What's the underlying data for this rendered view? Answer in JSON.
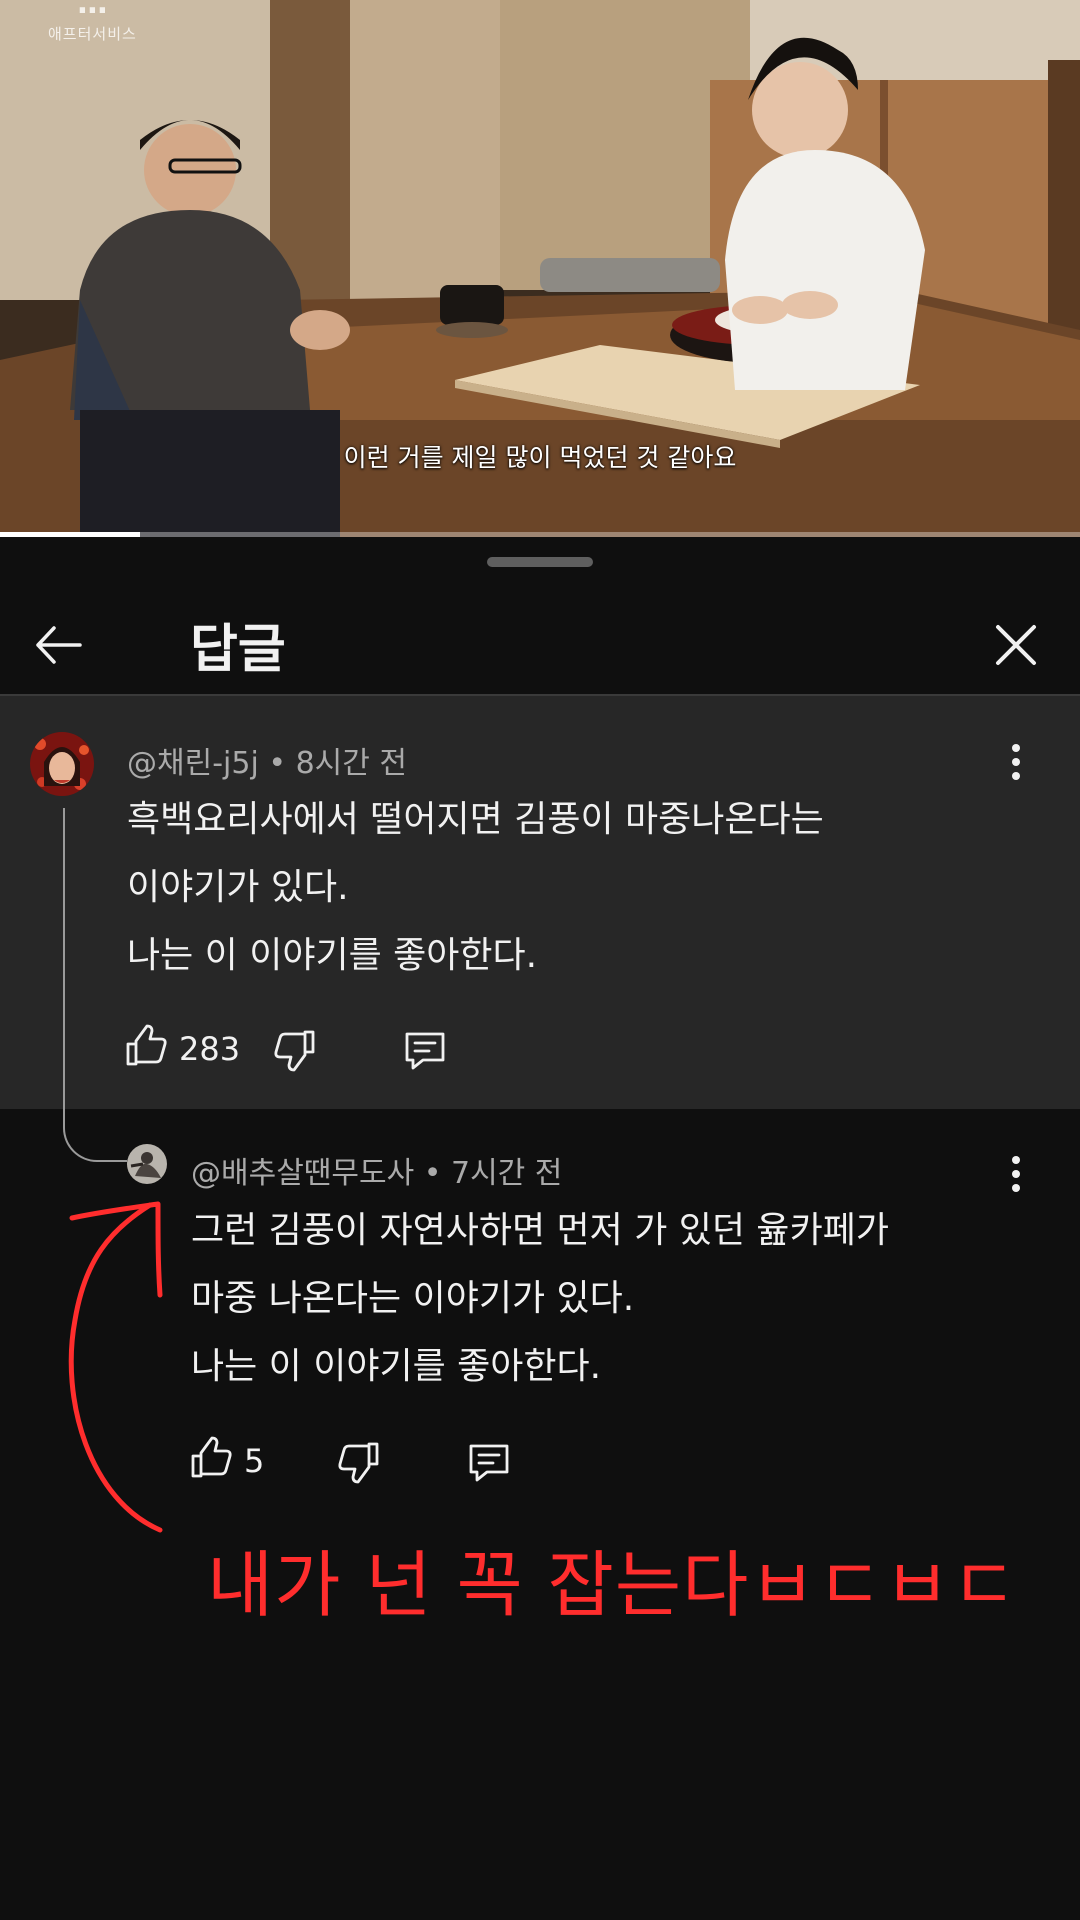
{
  "video": {
    "channel_logo_line1": "…",
    "channel_logo_line2": "애프터서비스",
    "subtitle": "이런 거를 제일 많이 먹었던 것 같아요",
    "progress_fraction": 0.13
  },
  "header": {
    "title": "답글"
  },
  "comment": {
    "author": "@채린-j5j",
    "time": "8시간 전",
    "lines": [
      "흑백요리사에서 떨어지면 김풍이 마중나온다는",
      "이야기가 있다.",
      "나는 이 이야기를 좋아한다."
    ],
    "like_count": "283"
  },
  "reply": {
    "author": "@배추살땐무도사",
    "time": "7시간 전",
    "lines": [
      "그런 김풍이 자연사하면 먼저 가 있던 윮카페가",
      "마중 나온다는 이야기가 있다.",
      "나는 이 이야기를 좋아한다."
    ],
    "like_count": "5"
  },
  "annotation": {
    "text": "내가 넌 꼭 잡는다ㅂㄷㅂㄷ",
    "color": "#ff2d2d"
  },
  "colors": {
    "background": "#0f0f0f",
    "parent_comment_bg": "#272727",
    "meta_text": "#aaaaaa"
  }
}
